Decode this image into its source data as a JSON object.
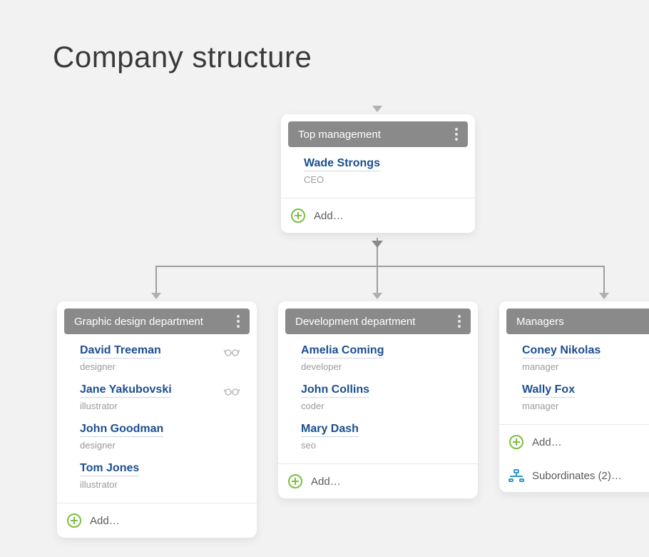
{
  "page_title": "Company structure",
  "add_label": "Add…",
  "top_card": {
    "title": "Top management",
    "people": [
      {
        "name": "Wade Strongs",
        "role": "CEO"
      }
    ]
  },
  "cards": [
    {
      "title": "Graphic design department",
      "people": [
        {
          "name": "David Treeman",
          "role": "designer",
          "glasses": true
        },
        {
          "name": "Jane Yakubovski",
          "role": "illustrator",
          "glasses": true
        },
        {
          "name": "John Goodman",
          "role": "designer"
        },
        {
          "name": "Tom Jones",
          "role": "illustrator"
        }
      ]
    },
    {
      "title": "Development department",
      "people": [
        {
          "name": "Amelia Coming",
          "role": "developer"
        },
        {
          "name": "John Collins",
          "role": "coder"
        },
        {
          "name": "Mary Dash",
          "role": "seo"
        }
      ]
    },
    {
      "title": "Managers",
      "subordinates_label": "Subordinates (2)…",
      "people": [
        {
          "name": "Coney Nikolas",
          "role": "manager"
        },
        {
          "name": "Wally Fox",
          "role": "manager"
        }
      ]
    }
  ]
}
